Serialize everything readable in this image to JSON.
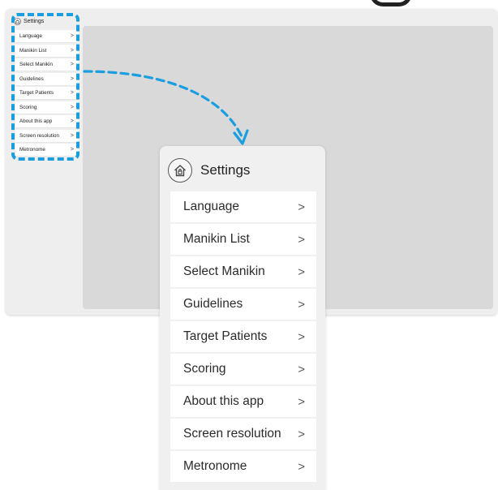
{
  "settings": {
    "title": "Settings",
    "items": [
      {
        "label": "Language",
        "chevron": ">"
      },
      {
        "label": "Manikin List",
        "chevron": ">"
      },
      {
        "label": "Select Manikin",
        "chevron": ">"
      },
      {
        "label": "Guidelines",
        "chevron": ">"
      },
      {
        "label": "Target Patients",
        "chevron": ">"
      },
      {
        "label": "Scoring",
        "chevron": ">"
      },
      {
        "label": "About this app",
        "chevron": ">"
      },
      {
        "label": "Screen resolution",
        "chevron": ">"
      },
      {
        "label": "Metronome",
        "chevron": ">"
      }
    ]
  },
  "icons": {
    "header_icon": "home-lock-icon",
    "row_icon": "chevron-right-icon",
    "annotation_arrow": "dashed-arrow-icon"
  },
  "colors": {
    "highlight": "#1a9ee0",
    "content_placeholder": "#d9d9d9",
    "frame_background": "#eeeeee",
    "row_background": "#ffffff"
  }
}
